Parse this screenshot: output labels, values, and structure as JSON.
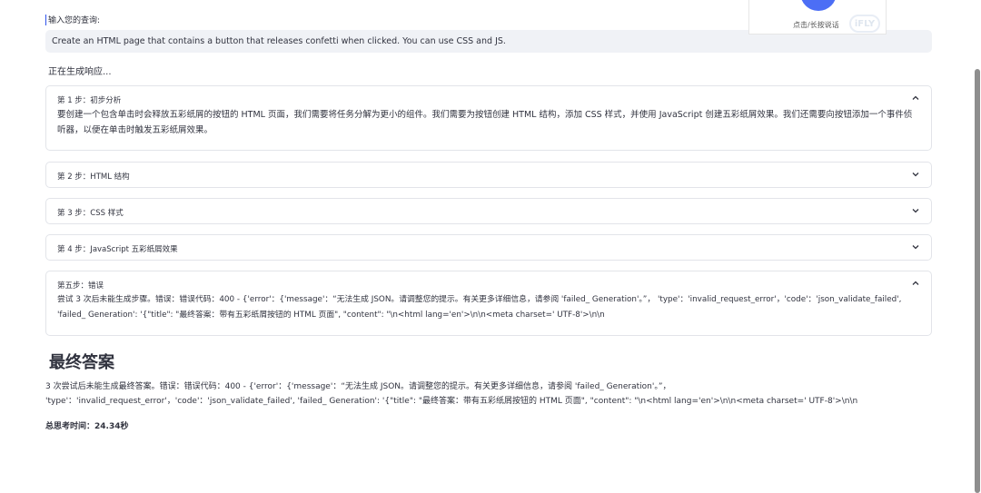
{
  "query": {
    "label": "输入您的查询:",
    "value": "Create an HTML page that contains a button that releases confetti when clicked. You can use CSS and JS."
  },
  "status": "正在生成响应...",
  "steps": [
    {
      "title": "第 1 步：初步分析",
      "expanded": true,
      "content": "要创建一个包含单击时会释放五彩纸屑的按钮的 HTML 页面，我们需要将任务分解为更小的组件。我们需要为按钮创建 HTML 结构，添加 CSS 样式，并使用 JavaScript 创建五彩纸屑效果。我们还需要向按钮添加一个事件侦听器，以便在单击时触发五彩纸屑效果。"
    },
    {
      "title": "第 2 步：HTML 结构",
      "expanded": false
    },
    {
      "title": "第 3 步：CSS 样式",
      "expanded": false
    },
    {
      "title": "第 4 步：JavaScript 五彩纸屑效果",
      "expanded": false
    },
    {
      "title": "第五步：错误",
      "expanded": true,
      "content": "尝试 3 次后未能生成步骤。错误：错误代码：400 - {'error'：{'message'：“无法生成 JSON。请调整您的提示。有关更多详细信息，请参阅 'failed_ Generation'。”， 'type'：'invalid_request_error'，'code'：'json_validate_failed', 'failed_ Generation': '{\"title\": \"最终答案：带有五彩纸屑按钮的 HTML 页面\", \"content\": \"\\n<html lang='en'>\\n\\n<meta charset=' UTF-8'>\\n\\n"
    }
  ],
  "final": {
    "title": "最终答案",
    "text": "3 次尝试后未能生成最终答案。错误：错误代码：400 - {'error'：{'message'：“无法生成 JSON。请调整您的提示。有关更多详细信息，请参阅 'failed_ Generation'。”， 'type'：'invalid_request_error'，'code'：'json_validate_failed', 'failed_ Generation': '{\"title\": \"最终答案：带有五彩纸屑按钮的 HTML 页面\", \"content\": \"\\n<html lang='en'>\\n\\n<meta charset=' UTF-8'>\\n\\n",
    "time": "总思考时间：24.34秒"
  },
  "voice_widget": {
    "label": "点击/长按说话",
    "logo": "iFLY",
    "icon": "plus-icon",
    "accent": "#4c6ef5"
  },
  "icons": {
    "expanded": "chevron-up-icon",
    "collapsed": "chevron-down-icon"
  }
}
